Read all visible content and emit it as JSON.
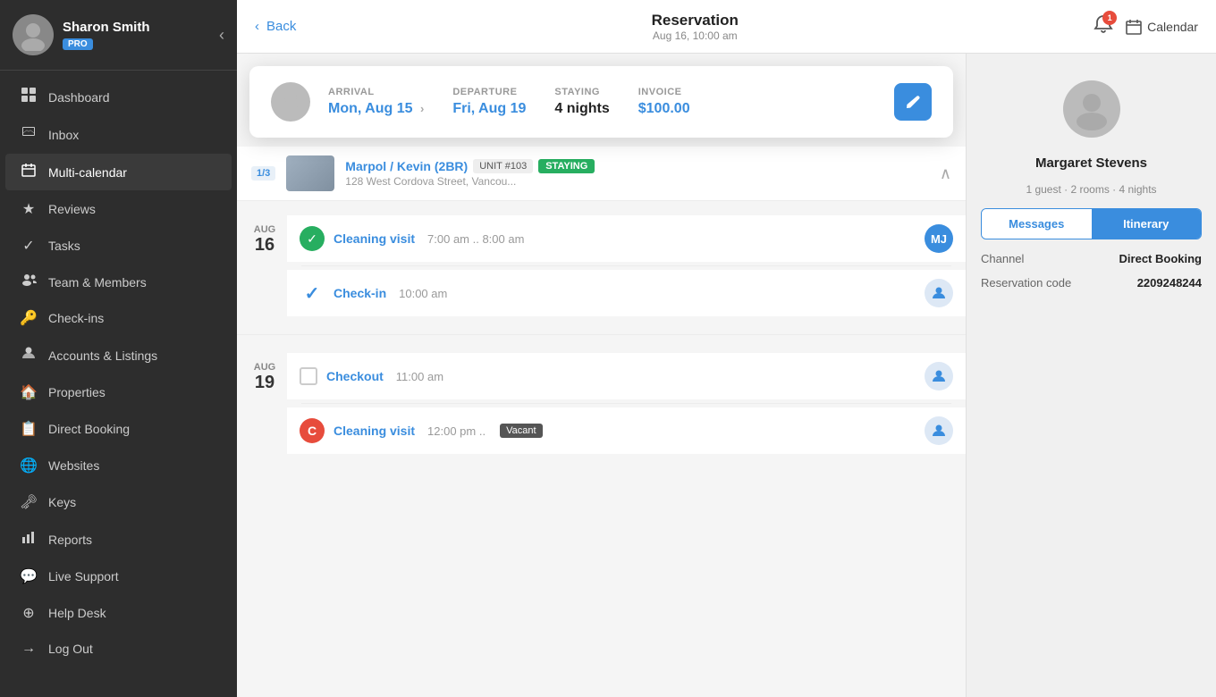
{
  "sidebar": {
    "user": {
      "name": "Sharon Smith",
      "badge": "PRO"
    },
    "nav": [
      {
        "id": "dashboard",
        "icon": "⊞",
        "label": "Dashboard"
      },
      {
        "id": "inbox",
        "icon": "✉",
        "label": "Inbox"
      },
      {
        "id": "multi-calendar",
        "icon": "📅",
        "label": "Multi-calendar",
        "active": true
      },
      {
        "id": "reviews",
        "icon": "★",
        "label": "Reviews"
      },
      {
        "id": "tasks",
        "icon": "✓",
        "label": "Tasks"
      },
      {
        "id": "team",
        "icon": "👥",
        "label": "Team & Members"
      },
      {
        "id": "checkins",
        "icon": "🔑",
        "label": "Check-ins"
      },
      {
        "id": "accounts",
        "icon": "👤",
        "label": "Accounts & Listings"
      },
      {
        "id": "properties",
        "icon": "🏠",
        "label": "Properties"
      },
      {
        "id": "direct-booking",
        "icon": "📋",
        "label": "Direct Booking"
      },
      {
        "id": "websites",
        "icon": "🌐",
        "label": "Websites"
      },
      {
        "id": "keys",
        "icon": "🔑",
        "label": "Keys"
      },
      {
        "id": "reports",
        "icon": "📊",
        "label": "Reports"
      },
      {
        "id": "live-support",
        "icon": "💬",
        "label": "Live Support"
      },
      {
        "id": "help-desk",
        "icon": "⚽",
        "label": "Help Desk"
      },
      {
        "id": "log-out",
        "icon": "→",
        "label": "Log Out"
      }
    ]
  },
  "topbar": {
    "back_label": "Back",
    "title": "Reservation",
    "subtitle": "Aug 16, 10:00 am",
    "notif_count": "1",
    "calendar_label": "Calendar"
  },
  "reservation_card": {
    "arrival_label": "ARRIVAL",
    "arrival_value": "Mon, Aug 15",
    "departure_label": "DEPARTURE",
    "departure_value": "Fri, Aug 19",
    "staying_label": "STAYING",
    "staying_value": "4 nights",
    "invoice_label": "INVOICE",
    "invoice_value": "$100.00"
  },
  "booking": {
    "page_label": "1/3",
    "property_name": "Marpol / Kevin (2BR)",
    "unit": "UNIT #103",
    "status": "STAYING",
    "address": "128 West Cordova Street, Vancou...",
    "days": [
      {
        "month": "AUG",
        "num": "16",
        "events": [
          {
            "type": "cleaning",
            "name": "Cleaning visit",
            "time": "7:00 am .. 8:00 am",
            "initials": "MJ",
            "icon_type": "green-check"
          },
          {
            "type": "checkin",
            "name": "Check-in",
            "time": "10:00 am",
            "icon_type": "blue-check"
          }
        ]
      },
      {
        "month": "AUG",
        "num": "19",
        "events": [
          {
            "type": "checkout",
            "name": "Checkout",
            "time": "11:00 am",
            "icon_type": "checkbox"
          },
          {
            "type": "cleaning",
            "name": "Cleaning visit",
            "time": "12:00 pm ..",
            "badge": "Vacant",
            "icon_type": "red-c"
          }
        ]
      }
    ]
  },
  "right_panel": {
    "guest_name": "Margaret Stevens",
    "guest_info": "1 guest · 2 rooms · 4 nights",
    "tab_messages": "Messages",
    "tab_itinerary": "Itinerary",
    "active_tab": "itinerary",
    "channel_label": "Channel",
    "channel_value": "Direct Booking",
    "res_code_label": "Reservation code",
    "res_code_value": "2209248244"
  }
}
